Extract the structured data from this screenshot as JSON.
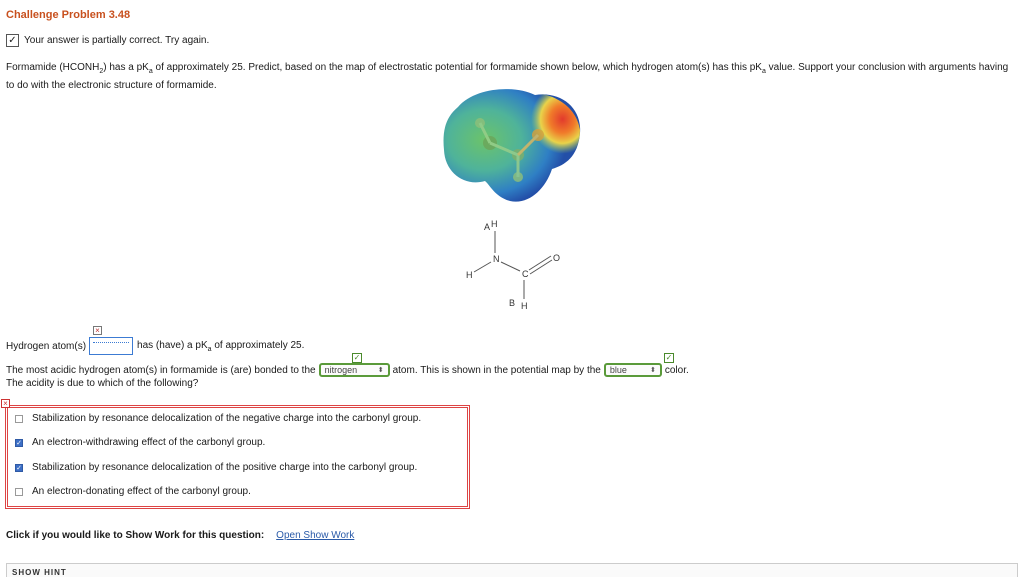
{
  "title": "Challenge Problem 3.48",
  "status": {
    "icon": "pencil-check-icon",
    "text": "Your answer is partially correct.  Try again."
  },
  "problem": {
    "p1": "Formamide (HCONH",
    "p1_sub": "2",
    "p2": ") has a pK",
    "p2_sub": "a",
    "p3": " of approximately 25. Predict, based on the map of electrostatic potential for formamide shown below, which hydrogen atom(s) has this pK",
    "p3_sub": "a",
    "p4": " value. Support your conclusion with arguments having to do with the electronic structure of formamide."
  },
  "structure": {
    "label_a": "A",
    "label_b": "B",
    "h_top": "H",
    "n": "N",
    "h_left": "H",
    "c": "C",
    "o": "O",
    "h_bottom": "H"
  },
  "question1": {
    "pre": "Hydrogen atom(s)",
    "input_value": "",
    "post1": "has (have) a pK",
    "post_sub": "a",
    "post2": " of approximately 25."
  },
  "question2": {
    "pre": "The most acidic hydrogen atom(s) in formamide is (are) bonded to the",
    "select1": "nitrogen",
    "mid": "atom. This is shown in the potential map by the",
    "select2": "blue",
    "post": "color.",
    "line2": "The acidity is due to which of the following?"
  },
  "options": [
    {
      "label": "Stabilization by resonance delocalization of the negative charge into the carbonyl group.",
      "checked": false
    },
    {
      "label": "An electron-withdrawing effect of the carbonyl group.",
      "checked": true
    },
    {
      "label": "Stabilization by resonance delocalization of the positive charge into the carbonyl group.",
      "checked": true
    },
    {
      "label": "An electron-donating effect of the carbonyl group.",
      "checked": false
    }
  ],
  "show_work": {
    "prompt": "Click if you would like to Show Work for this question:",
    "link": "Open Show Work"
  },
  "bottom_bar": {
    "label": "SHOW HINT"
  },
  "colors": {
    "title": "#c8511f",
    "link": "#2a5aa8",
    "incorrect": "#dd4444",
    "correct": "#5a9a3a",
    "checkbox": "#3d6fc6"
  }
}
